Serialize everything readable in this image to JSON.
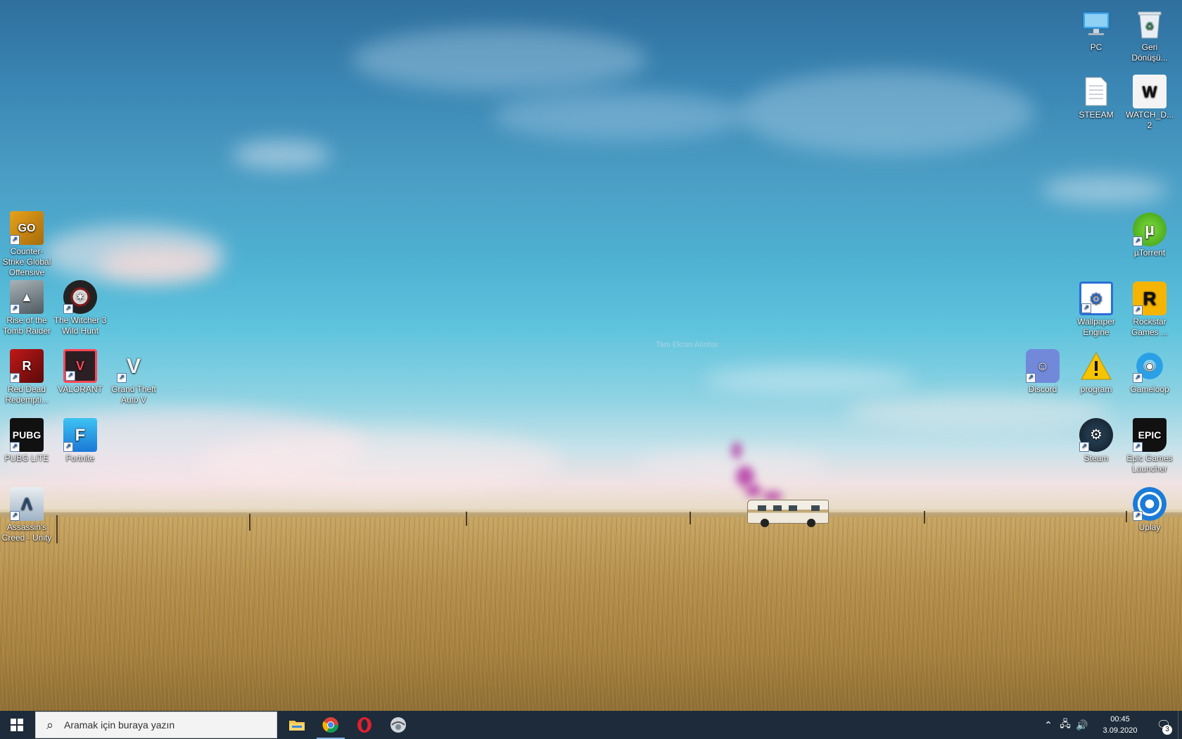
{
  "desktop": {
    "watermark": "Tam Ekran Alıntısı",
    "left_icons": [
      {
        "label": "Counter-Strike Global Offensive",
        "icon": "csgo-icon"
      },
      {
        "label": "Rise of the Tomb Raider",
        "icon": "tomb-raider-icon"
      },
      {
        "label": "The Witcher 3 Wild Hunt",
        "icon": "witcher-icon"
      },
      {
        "label": "Red Dead Redempti...",
        "icon": "red-dead-icon"
      },
      {
        "label": "VALORANT",
        "icon": "valorant-icon"
      },
      {
        "label": "Grand Theft Auto V",
        "icon": "gta-v-icon"
      },
      {
        "label": "PUBG LITE",
        "icon": "pubg-icon"
      },
      {
        "label": "Fortnite",
        "icon": "fortnite-icon"
      },
      {
        "label": "Assassin's Creed - Unity",
        "icon": "assassins-creed-icon"
      }
    ],
    "right_icons": [
      {
        "label": "PC",
        "icon": "computer-icon"
      },
      {
        "label": "Geri Dönüşü...",
        "icon": "recycle-bin-icon"
      },
      {
        "label": "STEEAM",
        "icon": "text-file-icon"
      },
      {
        "label": "WATCH_D... 2",
        "icon": "watch-dogs-icon"
      },
      {
        "label": "µTorrent",
        "icon": "utorrent-icon"
      },
      {
        "label": "Wallpaper Engine",
        "icon": "wallpaper-engine-icon"
      },
      {
        "label": "Rockstar Games ...",
        "icon": "rockstar-icon"
      },
      {
        "label": "Discord",
        "icon": "discord-icon"
      },
      {
        "label": "program",
        "icon": "warning-icon"
      },
      {
        "label": "Gameloop",
        "icon": "gameloop-icon"
      },
      {
        "label": "Steam",
        "icon": "steam-icon"
      },
      {
        "label": "Epic Games Launcher",
        "icon": "epic-games-icon"
      },
      {
        "label": "Uplay",
        "icon": "uplay-icon"
      }
    ]
  },
  "taskbar": {
    "search_placeholder": "Aramak için buraya yazın",
    "apps": [
      {
        "name": "File Explorer",
        "icon": "folder-icon",
        "active": false
      },
      {
        "name": "Google Chrome",
        "icon": "chrome-icon",
        "active": true
      },
      {
        "name": "Opera",
        "icon": "opera-icon",
        "active": false
      },
      {
        "name": "App",
        "icon": "app-icon",
        "active": false
      }
    ],
    "clock": {
      "time": "00:45",
      "date": "3.09.2020"
    },
    "notification_count": "3"
  }
}
